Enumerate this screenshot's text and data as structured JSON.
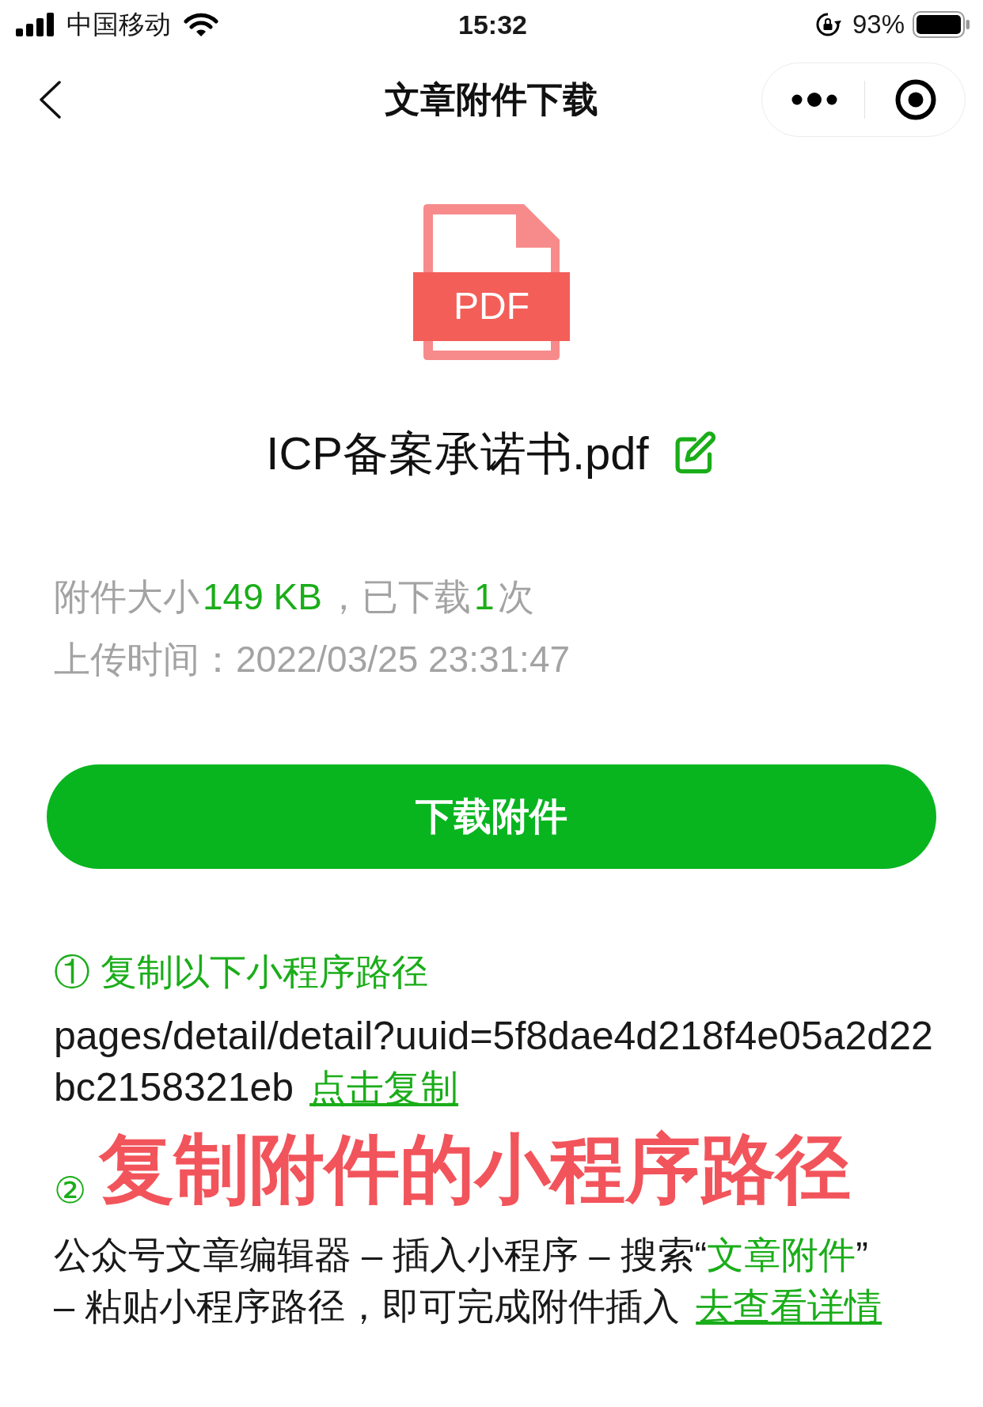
{
  "status_bar": {
    "carrier": "中国移动",
    "time": "15:32",
    "battery": "93%"
  },
  "nav_bar": {
    "title": "文章附件下载"
  },
  "file": {
    "type_label": "PDF",
    "name": "ICP备案承诺书.pdf"
  },
  "info": [
    {
      "parts": [
        {
          "kind": "text",
          "text": "附件大小"
        },
        {
          "kind": "highlight",
          "text": "149 KB"
        },
        {
          "kind": "text",
          "text": "，已下载"
        },
        {
          "kind": "highlight",
          "text": "1"
        },
        {
          "kind": "text",
          "text": "次"
        }
      ]
    },
    {
      "parts": [
        {
          "kind": "text",
          "text": "上传时间：2022/03/25 23:31:47"
        }
      ]
    }
  ],
  "download_button": {
    "label": "下载附件"
  },
  "steps": [
    {
      "title": "① 复制以下小程序路径",
      "body": [
        {
          "kind": "text",
          "text": "pages/detail/detail?uuid=5f8dae4d218f4e05a2d22bc2158321eb"
        },
        {
          "kind": "link",
          "text": "点击复制"
        }
      ]
    },
    {
      "title": "②",
      "body": [
        {
          "kind": "text",
          "text": "公众号文章编辑器 – 插入小程序 – 搜索“"
        },
        {
          "kind": "highlight",
          "text": "文章附件"
        },
        {
          "kind": "text",
          "text": "” – 粘贴小程序路径，即可完成附件插入"
        },
        {
          "kind": "link",
          "text": "去查看详情"
        }
      ]
    }
  ],
  "annotation": {
    "text": "复制附件的小程序路径"
  }
}
